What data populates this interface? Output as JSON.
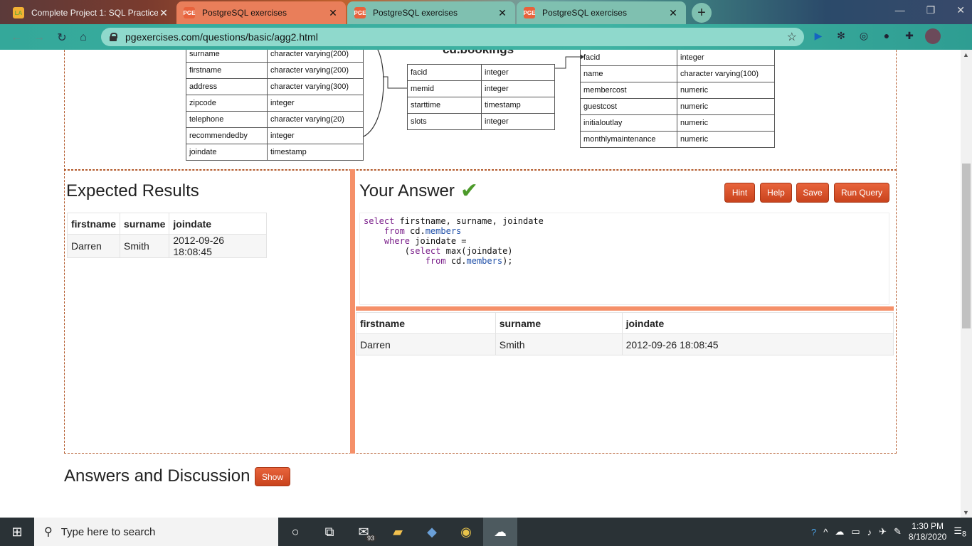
{
  "browser": {
    "tabs": [
      {
        "title": "Complete Project 1: SQL Practice",
        "favicon": "LA"
      },
      {
        "title": "PostgreSQL exercises",
        "favicon": "PGE"
      },
      {
        "title": "PostgreSQL exercises",
        "favicon": "PGE"
      },
      {
        "title": "PostgreSQL exercises",
        "favicon": "PGE"
      }
    ],
    "url": "pgexercises.com/questions/basic/agg2.html"
  },
  "schema": {
    "members_rows": [
      [
        "surname",
        "character varying(200)"
      ],
      [
        "firstname",
        "character varying(200)"
      ],
      [
        "address",
        "character varying(300)"
      ],
      [
        "zipcode",
        "integer"
      ],
      [
        "telephone",
        "character varying(20)"
      ],
      [
        "recommendedby",
        "integer"
      ],
      [
        "joindate",
        "timestamp"
      ]
    ],
    "bookings_title": "cd.bookings",
    "bookings_rows": [
      [
        "facid",
        "integer"
      ],
      [
        "memid",
        "integer"
      ],
      [
        "starttime",
        "timestamp"
      ],
      [
        "slots",
        "integer"
      ]
    ],
    "facilities_rows": [
      [
        "facid",
        "integer"
      ],
      [
        "name",
        "character varying(100)"
      ],
      [
        "membercost",
        "numeric"
      ],
      [
        "guestcost",
        "numeric"
      ],
      [
        "initialoutlay",
        "numeric"
      ],
      [
        "monthlymaintenance",
        "numeric"
      ]
    ]
  },
  "expected": {
    "title": "Expected Results",
    "columns": [
      "firstname",
      "surname",
      "joindate"
    ],
    "rows": [
      [
        "Darren",
        "Smith",
        "2012-09-26 18:08:45"
      ]
    ]
  },
  "answer": {
    "title": "Your Answer",
    "buttons": {
      "hint": "Hint",
      "help": "Help",
      "save": "Save",
      "run": "Run Query"
    },
    "query_lines": {
      "l1a": "select",
      "l1b": " firstname, surname, joindate",
      "l2a": "    from",
      "l2b": " cd.",
      "l2c": "members",
      "l3a": "    where",
      "l3b": " joindate =",
      "l4a": "        (",
      "l4b": "select",
      "l4c": " max(joindate)",
      "l5a": "            from",
      "l5b": " cd.",
      "l5c": "members",
      "l5d": ");"
    },
    "columns": [
      "firstname",
      "surname",
      "joindate"
    ],
    "rows": [
      [
        "Darren",
        "Smith",
        "2012-09-26 18:08:45"
      ]
    ]
  },
  "discussion": {
    "title": "Answers and Discussion",
    "show_label": "Show"
  },
  "taskbar": {
    "search_placeholder": "Type here to search",
    "mail_badge": "93",
    "time": "1:30 PM",
    "date": "8/18/2020",
    "notif_count": "8"
  }
}
